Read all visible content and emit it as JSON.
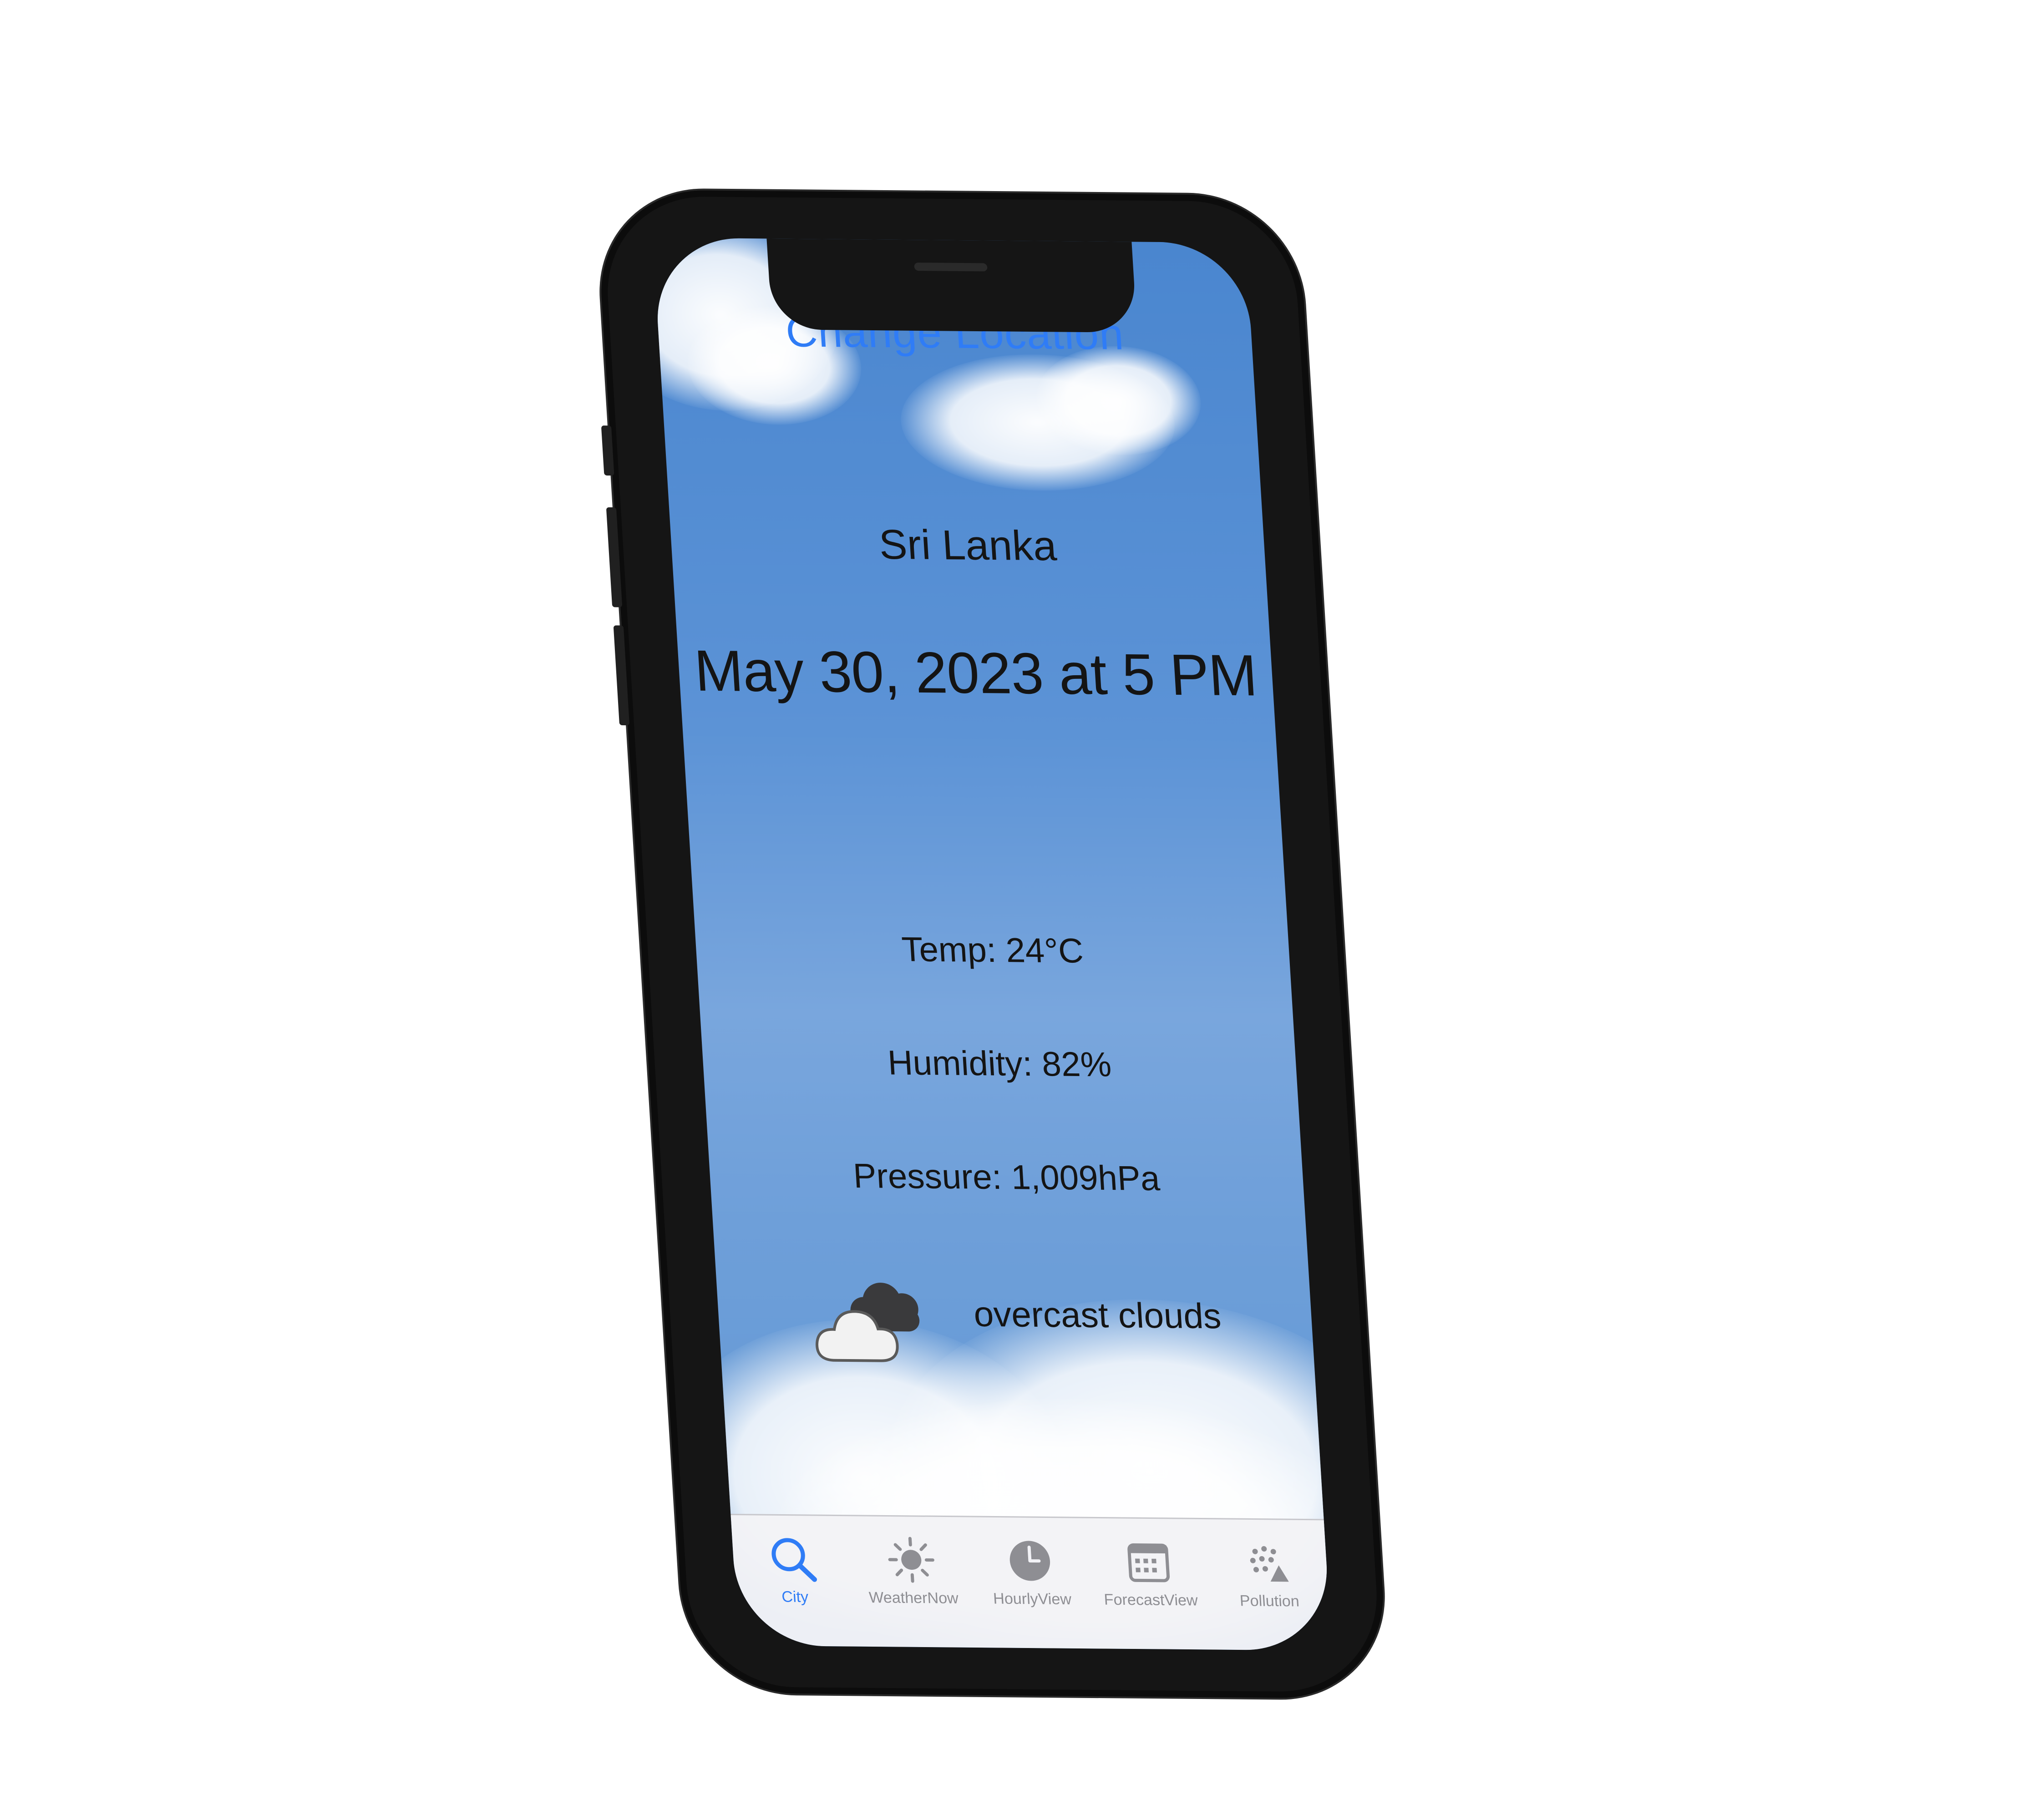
{
  "header": {
    "change_location_label": "Change Location"
  },
  "location": {
    "country": "Sri Lanka",
    "datetime": "May 30, 2023 at 5 PM"
  },
  "stats": {
    "temp": "Temp: 24°C",
    "humidity": "Humidity: 82%",
    "pressure": "Pressure: 1,009hPa"
  },
  "condition": {
    "icon": "cloud-icon",
    "description": "overcast clouds"
  },
  "tabs": [
    {
      "label": "City",
      "icon": "search-icon",
      "active": true
    },
    {
      "label": "WeatherNow",
      "icon": "sun-icon",
      "active": false
    },
    {
      "label": "HourlyView",
      "icon": "clock-icon",
      "active": false
    },
    {
      "label": "ForecastView",
      "icon": "calendar-icon",
      "active": false
    },
    {
      "label": "Pollution",
      "icon": "pollution-icon",
      "active": false
    }
  ],
  "colors": {
    "accent": "#2f7cf6",
    "sky": "#5c93d6",
    "text": "#141414",
    "tab_inactive": "#8e8e93"
  }
}
